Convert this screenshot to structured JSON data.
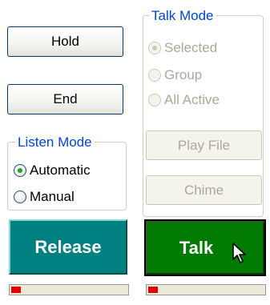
{
  "buttons": {
    "hold": "Hold",
    "end": "End",
    "play_file": "Play File",
    "chime": "Chime",
    "release": "Release",
    "talk": "Talk"
  },
  "listen_mode": {
    "title": "Listen Mode",
    "options": [
      {
        "label": "Automatic",
        "selected": true
      },
      {
        "label": "Manual",
        "selected": false
      }
    ]
  },
  "talk_mode": {
    "title": "Talk Mode",
    "options": [
      {
        "label": "Selected",
        "selected": true
      },
      {
        "label": "Group",
        "selected": false
      },
      {
        "label": "All Active",
        "selected": false
      }
    ]
  },
  "meters": {
    "listen_level": 0.08,
    "talk_level": 0.08,
    "fill_color": "#e00000"
  },
  "colors": {
    "release_bg": "#008080",
    "talk_bg": "#007a00",
    "legend_text": "#0046d5"
  }
}
